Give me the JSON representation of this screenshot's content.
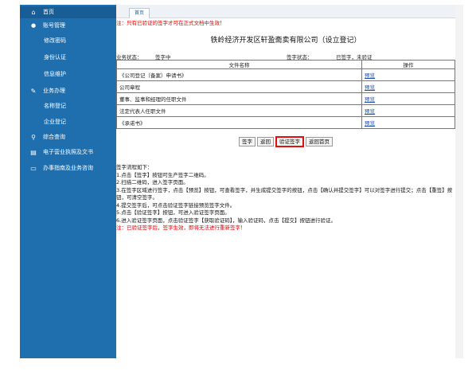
{
  "sidebar": {
    "items": [
      {
        "icon": "home-icon",
        "glyph": "⌂",
        "label": "首页",
        "active": true
      },
      {
        "icon": "user-icon",
        "glyph": "👤",
        "label": "账号管理"
      },
      {
        "icon": "",
        "glyph": "",
        "label": "修改密码",
        "sub": true
      },
      {
        "icon": "",
        "glyph": "",
        "label": "身份认证",
        "sub": true
      },
      {
        "icon": "",
        "glyph": "",
        "label": "信息维护",
        "sub": true
      },
      {
        "icon": "edit-icon",
        "glyph": "✎",
        "label": "业务办理"
      },
      {
        "icon": "",
        "glyph": "",
        "label": "名称登记",
        "sub": true
      },
      {
        "icon": "",
        "glyph": "",
        "label": "企业登记",
        "sub": true
      },
      {
        "icon": "search-icon",
        "glyph": "⚲",
        "label": "综合查询"
      },
      {
        "icon": "document-icon",
        "glyph": "▤",
        "label": "电子营业执照及文书"
      },
      {
        "icon": "chat-icon",
        "glyph": "▭",
        "label": "办事指南及业务咨询"
      }
    ]
  },
  "tabs": {
    "home": "首页"
  },
  "notice": "注：只有已验证的签字才可在正式文档中生效！",
  "company_title": "铁岭经济开发区轩盈斋卖有限公司（设立登记）",
  "status": {
    "business_label": "业务状态：",
    "business_value": "签字中",
    "sign_label": "签字状态：",
    "sign_value": "已签字，未验证"
  },
  "table": {
    "headers": [
      "文件名称",
      "操作"
    ],
    "rows": [
      {
        "name": "《公司登记（备案）申请书》",
        "action": "预览"
      },
      {
        "name": "公司章程",
        "action": "预览"
      },
      {
        "name": "董事、监事和经理的任职文件",
        "action": "预览"
      },
      {
        "name": "法定代表人任职文件",
        "action": "预览"
      },
      {
        "name": "《承诺书》",
        "action": "预览"
      }
    ]
  },
  "buttons": {
    "sign": "签字",
    "back": "返回",
    "verify": "验证签字",
    "home": "返回首页"
  },
  "instructions": {
    "title": "签字流程如下：",
    "steps": [
      "1.点击【签字】按钮可生产签字二维码。",
      "2.扫描二维码，进入签字页面。",
      "3.在签字区域进行签字，点击【预览】按钮，可查看签字，并生成提交签字的按钮，点击【确认并提交签字】可以对签字进行提交；点击【重签】按钮，可清空签字。",
      "4.提交签字后，可点击验证签字链接预览签字文件。",
      "5.点击【验证签字】按钮，可进入验证签字页面。",
      "6.进入验证签字页面，点击验证签字【获取验证码】，输入验证码，点击【提交】按钮进行验证。"
    ],
    "warning": "注：已验证签字后，签字生效，即将无法进行重新签字！"
  }
}
